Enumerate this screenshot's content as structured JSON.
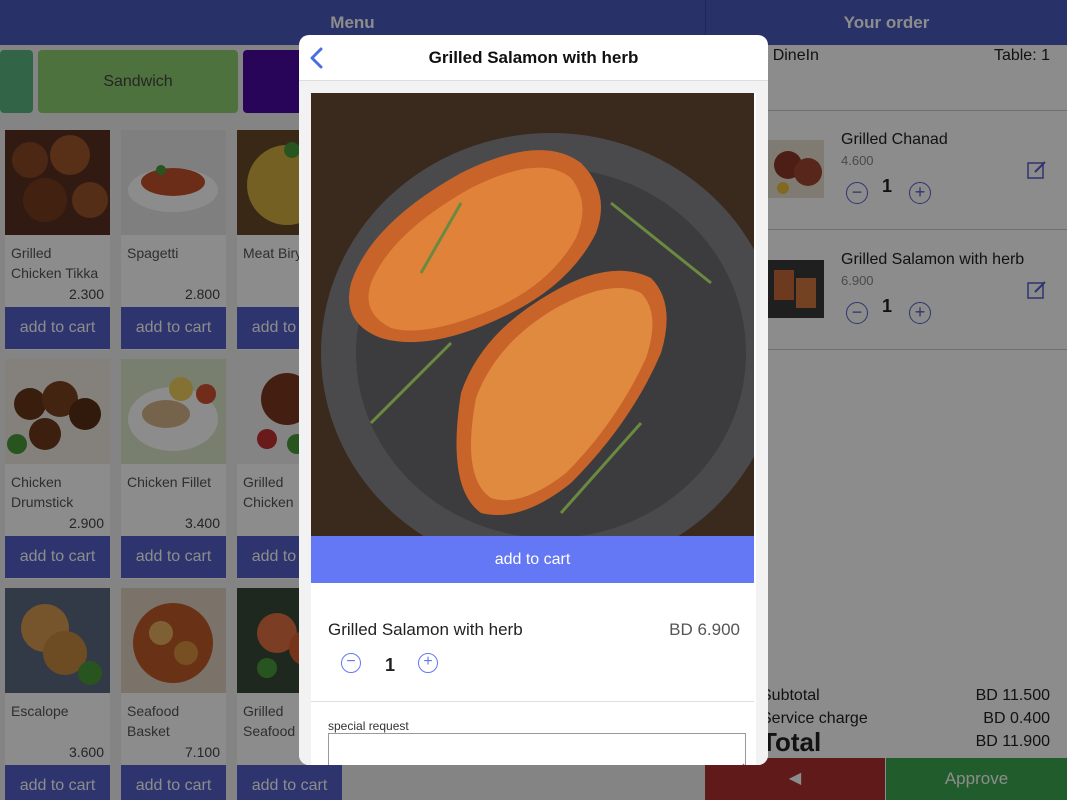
{
  "header": {
    "menu_title": "Menu",
    "order_title": "Your order"
  },
  "categories": [
    {
      "label": "",
      "color": "#5cb883"
    },
    {
      "label": "Sandwich",
      "color": "#8fcf6f"
    },
    {
      "label": "",
      "color": "#4a0aa0"
    }
  ],
  "menu_items": [
    {
      "name": "Grilled Chicken Tikka",
      "price": "2.300",
      "add_label": "add to cart"
    },
    {
      "name": "Spagetti",
      "price": "2.800",
      "add_label": "add to cart"
    },
    {
      "name": "Meat Biryani",
      "price": "",
      "add_label": "add to cart"
    },
    {
      "name": "Chicken Drumstick",
      "price": "2.900",
      "add_label": "add to cart"
    },
    {
      "name": "Chicken Fillet",
      "price": "3.400",
      "add_label": "add to cart"
    },
    {
      "name": "Grilled Chicken",
      "price": "",
      "add_label": "add to cart"
    },
    {
      "name": "Escalope",
      "price": "3.600",
      "add_label": "add to cart"
    },
    {
      "name": "Seafood Basket",
      "price": "7.100",
      "add_label": "add to cart"
    },
    {
      "name": "Grilled Seafood",
      "price": "",
      "add_label": "add to cart"
    }
  ],
  "order": {
    "service_label": "Service : DineIn",
    "table_label": "Table: 1",
    "items": [
      {
        "name": "Grilled Chanad",
        "price": "4.600",
        "qty": "1",
        "minus": "−",
        "plus": "+"
      },
      {
        "name": "Grilled Salamon with herb",
        "price": "6.900",
        "qty": "1",
        "minus": "−",
        "plus": "+"
      }
    ],
    "totals": [
      {
        "label": "Subtotal",
        "value": "BD 11.500"
      },
      {
        "label": "Service charge",
        "value": "BD 0.400"
      },
      {
        "label": "Total",
        "value": "BD 11.900"
      }
    ],
    "back_label": "◀",
    "approve_label": "Approve"
  },
  "modal": {
    "title": "Grilled Salamon with herb",
    "add_label": "add to cart",
    "item_name": "Grilled Salamon with herb",
    "item_price": "BD 6.900",
    "qty": "1",
    "minus": "−",
    "plus": "+",
    "special_request_label": "special request",
    "special_request_value": ""
  }
}
